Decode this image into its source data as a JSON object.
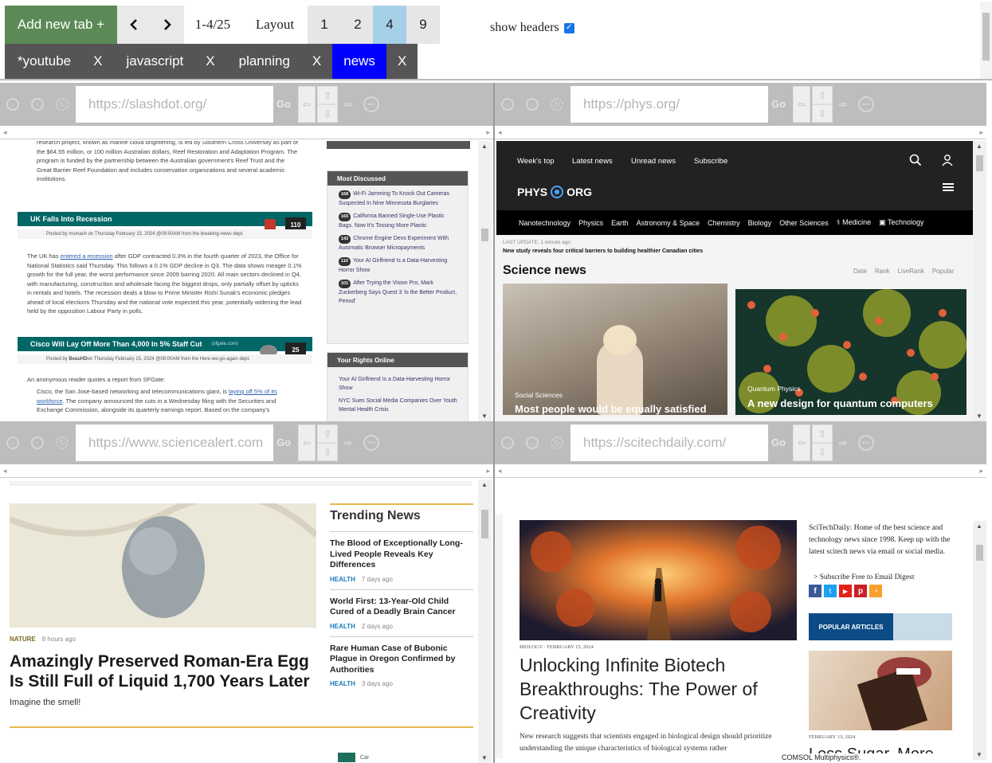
{
  "toolbar": {
    "add_tab_label": "Add new tab +",
    "prev_label": "‹",
    "next_label": "›",
    "page_count": "1-4/25",
    "layout_label": "Layout",
    "layout_options": [
      "1",
      "2",
      "4",
      "9"
    ],
    "layout_selected": "4",
    "show_headers_label": "show headers",
    "show_headers_checked": true
  },
  "tabs": [
    {
      "name": "*youtube",
      "close": "X"
    },
    {
      "name": "javascript",
      "close": "X"
    },
    {
      "name": "planning",
      "close": "X"
    },
    {
      "name": "news",
      "close": "X",
      "selected": true
    }
  ],
  "panes": [
    {
      "url": "https://slashdot.org/",
      "go": "Go"
    },
    {
      "url": "https://phys.org/",
      "go": "Go"
    },
    {
      "url": "https://www.sciencealert.com",
      "go": "Go"
    },
    {
      "url": "https://scitechdaily.com/",
      "go": "Go"
    }
  ],
  "slashdot": {
    "intro_text": "research project, known as marine cloud brightening, is led by Southern Cross University as part of the $64.55 million, or 100 million Australian dollars, Reef Restoration and Adaptation Program. The program is funded by the partnership between the Australian government's Reef Trust and the Great Barrier Reef Foundation and includes conservation organizations and several academic institutions.",
    "story1": {
      "title": "UK Falls Into Recession",
      "count": "110",
      "meta": "Posted by msmash on Thursday February 15, 2024 @09:00AM from the breaking-news dept.",
      "body_pre": "The UK has ",
      "body_link": "entered a recession",
      "body_post": " after GDP contracted 0.3% in the fourth quarter of 2023, the Office for National Statistics said Thursday. This follows a 0.1% GDP decline in Q3. The data shows meager 0.1% growth for the full year, the worst performance since 2009 barring 2020. All main sectors declined in Q4, with manufacturing, construction and wholesale facing the biggest drops, only partially offset by upticks in rentals and hotels. The recession deals a blow to Prime Minister Rishi Sunak's economic pledges ahead of local elections Thursday and the national vote expected this year, potentially widening the lead held by the opposition Labour Party in polls."
    },
    "story2": {
      "title": "Cisco Will Lay Off More Than 4,000 In 5% Staff Cut",
      "source": "(sfgate.com)",
      "count": "25",
      "meta_author": "BeauHD",
      "meta": " on Thursday February 15, 2024 @08:00AM from the Here-we-go-again dept.",
      "quote_intro": "An anonymous reader quotes a report from SFGate:",
      "body_pre": "Cisco, the San Jose-based networking and telecommunications giant, is ",
      "body_link": "laying off 5% of its workforce",
      "body_post": ". The company announced the cuts in a Wednesday filing with the Securities and Exchange Commission, alongside its quarterly earnings report. Based on the company's"
    },
    "most_discussed": {
      "heading": "Most Discussed",
      "items": [
        {
          "count": "168",
          "text": "Wi-Fi Jamming To Knock Out Cameras Suspected In Nine Minnesota Burglaries"
        },
        {
          "count": "165",
          "text": "California Banned Single-Use Plastic Bags. Now It's Tossing More Plastic"
        },
        {
          "count": "142",
          "text": "Chrome Engine Devs Experiment With Automatic Browser Micropayments"
        },
        {
          "count": "110",
          "text": "Your AI Girlfriend Is a Data-Harvesting Horror Show"
        },
        {
          "count": "101",
          "text": "After Trying the Vision Pro, Mark Zuckerberg Says Quest 3 'is the Better Product, Period'"
        }
      ]
    },
    "rights_online": {
      "heading": "Your Rights Online",
      "items": [
        "Your AI Girlfriend Is a Data-Harvesting Horror Show",
        "NYC Sues Social Media Companies Over Youth Mental Health Crisis"
      ]
    }
  },
  "phys": {
    "menu": [
      "Week's top",
      "Latest news",
      "Unread news",
      "Subscribe"
    ],
    "logo_left": "PHYS",
    "logo_right": "ORG",
    "categories": [
      "Nanotechnology",
      "Physics",
      "Earth",
      "Astronomy & Space",
      "Chemistry",
      "Biology",
      "Other Sciences",
      "Medicine",
      "Technology"
    ],
    "last_update": "LAST UPDATE: 1 minute ago",
    "latest_headline": "New study reveals four critical barriers to building healthier Canadian cities",
    "section_title": "Science news",
    "sort_options": [
      "Date",
      "Rank",
      "LiveRank",
      "Popular"
    ],
    "cards": [
      {
        "category": "Social Sciences",
        "title": "Most people would be equally satisfied"
      },
      {
        "category": "Quantum Physics",
        "title": "A new design for quantum computers"
      }
    ]
  },
  "sciencealert": {
    "main_category": "NATURE",
    "main_time": "8 hours ago",
    "main_title": "Amazingly Preserved Roman-Era Egg Is Still Full of Liquid 1,700 Years Later",
    "main_sub": "Imagine the smell!",
    "trending_heading": "Trending News",
    "trending": [
      {
        "title": "The Blood of Exceptionally Long-Lived People Reveals Key Differences",
        "tag": "HEALTH",
        "time": "7 days ago"
      },
      {
        "title": "World First: 13-Year-Old Child Cured of a Deadly Brain Cancer",
        "tag": "HEALTH",
        "time": "2 days ago"
      },
      {
        "title": "Rare Human Case of Bubonic Plague in Oregon Confirmed by Authorities",
        "tag": "HEALTH",
        "time": "3 days ago"
      }
    ],
    "bottom_partial": "Car"
  },
  "scitech": {
    "meta_category": "BIOLOGY",
    "meta_date": "FEBRUARY 15, 2024",
    "title": "Unlocking Infinite Biotech Breakthroughs: The Power of Creativity",
    "excerpt": "New research suggests that scientists engaged in biological design should prioritize understanding the unique characteristics of biological systems rather",
    "about": "SciTechDaily: Home of the best science and technology news since 1998. Keep up with the latest scitech news via email or social media.",
    "subscribe": "> Subscribe Free to Email Digest",
    "popular_heading": "POPULAR ARTICLES",
    "popular_date": "FEBRUARY 13, 2024",
    "popular_title_partial": "Less Sugar, More",
    "footer_partial": "COMSOL Multiphysics®."
  }
}
